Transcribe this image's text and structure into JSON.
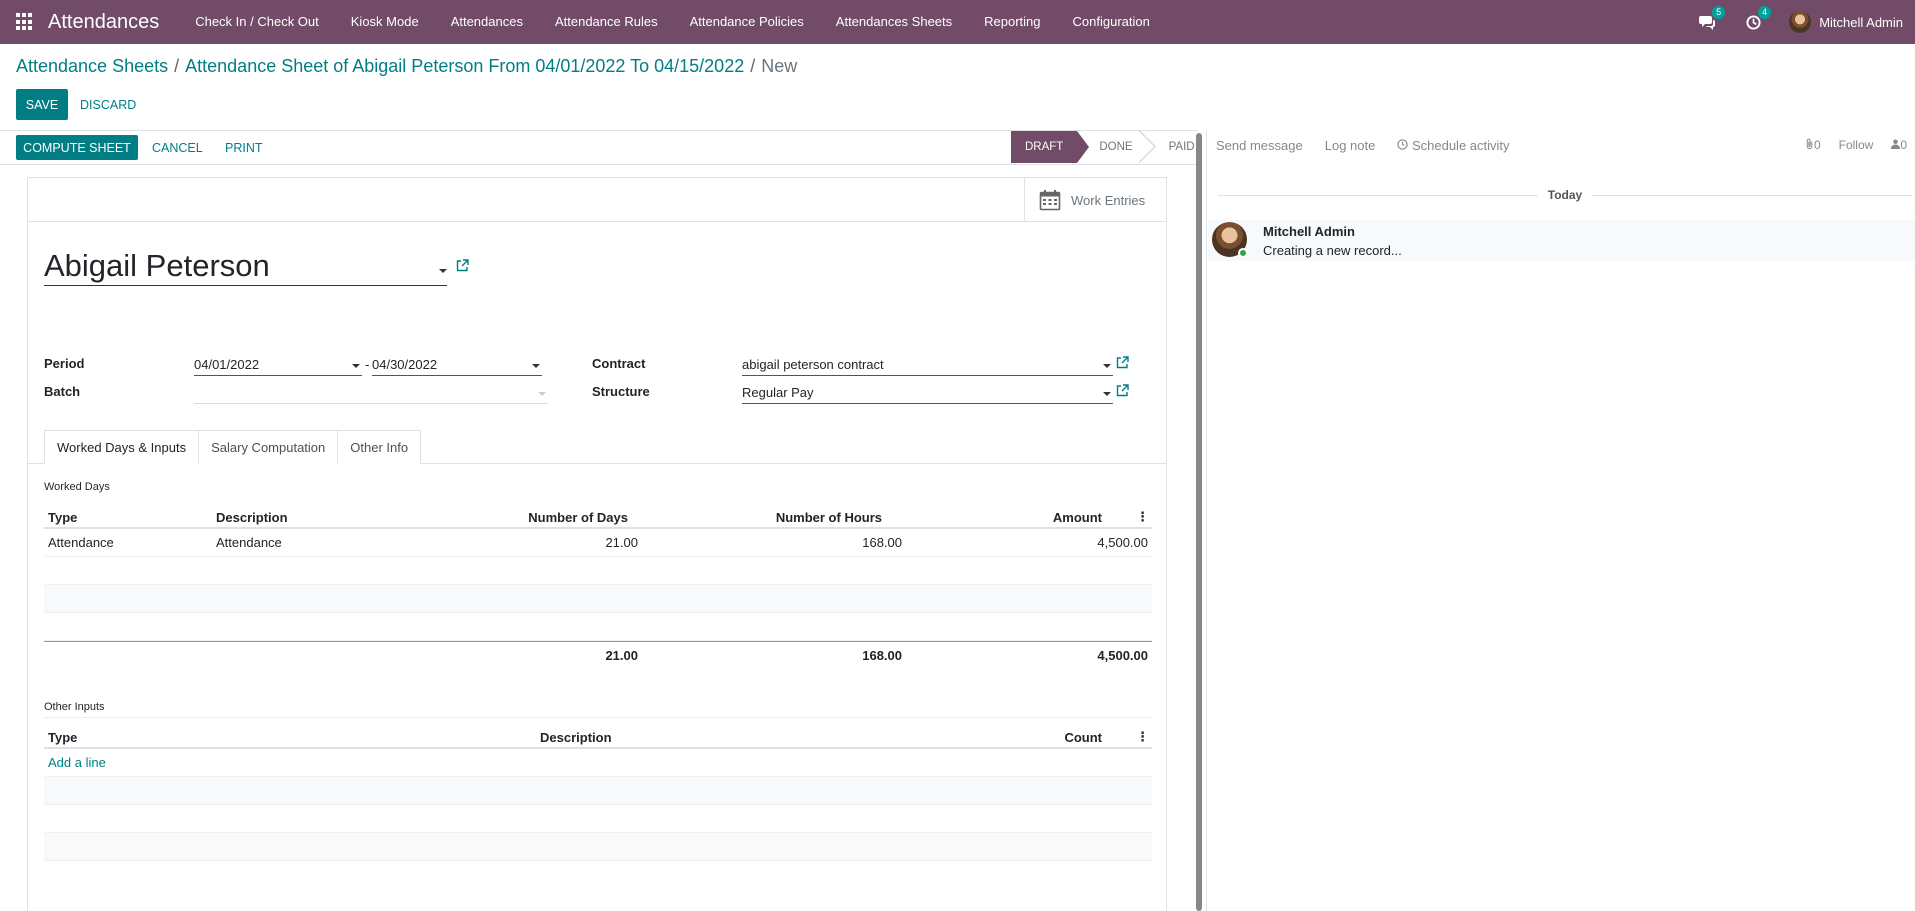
{
  "navbar": {
    "brand": "Attendances",
    "menu": [
      "Check In / Check Out",
      "Kiosk Mode",
      "Attendances",
      "Attendance Rules",
      "Attendance Policies",
      "Attendances Sheets",
      "Reporting",
      "Configuration"
    ],
    "messages_count": "5",
    "activities_count": "4",
    "user_name": "Mitchell Admin"
  },
  "breadcrumb": {
    "root": "Attendance Sheets",
    "record": "Attendance Sheet of Abigail Peterson From 04/01/2022 To 04/15/2022",
    "current": "New"
  },
  "control": {
    "save": "SAVE",
    "discard": "DISCARD"
  },
  "statusbar": {
    "buttons": [
      "COMPUTE SHEET",
      "CANCEL",
      "PRINT"
    ],
    "steps": [
      "DRAFT",
      "DONE",
      "PAID"
    ],
    "active_step": "DRAFT"
  },
  "sheet": {
    "stat_button": "Work Entries",
    "employee": "Abigail Peterson",
    "fields": {
      "period_label": "Period",
      "period_from": "04/01/2022",
      "period_sep": "-",
      "period_to": "04/30/2022",
      "batch_label": "Batch",
      "batch_value": "",
      "contract_label": "Contract",
      "contract_value": "abigail peterson contract",
      "structure_label": "Structure",
      "structure_value": "Regular Pay"
    },
    "tabs": [
      "Worked Days & Inputs",
      "Salary Computation",
      "Other Info"
    ],
    "worked_days": {
      "title": "Worked Days",
      "columns": [
        "Type",
        "Description",
        "Number of Days",
        "Number of Hours",
        "Amount"
      ],
      "rows": [
        [
          "Attendance",
          "Attendance",
          "21.00",
          "168.00",
          "4,500.00"
        ]
      ],
      "totals": [
        "21.00",
        "168.00",
        "4,500.00"
      ]
    },
    "other_inputs": {
      "title": "Other Inputs",
      "columns": [
        "Type",
        "Description",
        "Count"
      ],
      "add_line": "Add a line"
    }
  },
  "chatter": {
    "send_message": "Send message",
    "log_note": "Log note",
    "schedule_activity": "Schedule activity",
    "attachments_count": "0",
    "follow": "Follow",
    "followers_count": "0",
    "date_separator": "Today",
    "message": {
      "author": "Mitchell Admin",
      "body": "Creating a new record..."
    }
  },
  "colors": {
    "brand": "#714B67",
    "primary": "#017e84",
    "online": "#28a745",
    "badge": "#00A09D"
  }
}
